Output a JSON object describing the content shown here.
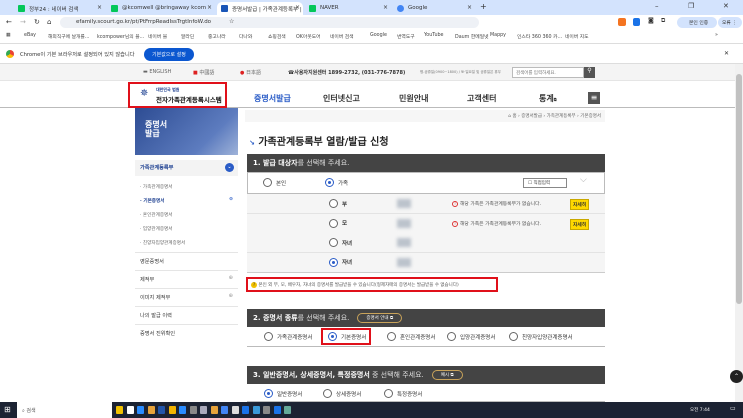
{
  "browser": {
    "tabs": [
      {
        "label": "정부24 : 네이버 검색"
      },
      {
        "label": "@kcomwell @bringaway kcom"
      },
      {
        "label": "증명서발급 | 가족관계등록부 |",
        "active": true
      },
      {
        "label": "NAVER"
      },
      {
        "label": "Google"
      }
    ],
    "url": "efamily.scourt.go.kr/pt/PtFrrpReadIssTrgtInfoW.do",
    "profile_label": "본인 인증",
    "menu_label": "오류",
    "bookmarks": [
      "eBay",
      "해외직구에 날개를...",
      "kcompower님의 블...",
      "네이버 블",
      "알라딘",
      "중고나라",
      "다나와",
      "쇼핑검색",
      "OK아웃도어",
      "네이버 검색",
      "Google",
      "번역도구",
      "YouTube",
      "Daum 한메일넷",
      "Mappy",
      "인스타 360 360 카...",
      "네이버 지도"
    ],
    "banner_text": "Chrome이 기본 브라우저로 설정되어 있지 않습니다",
    "banner_button": "기본값으로 설정"
  },
  "site": {
    "languages": [
      "ENGLISH",
      "中國語",
      "日本語"
    ],
    "helpdesk": "사용자지원센터 1899-2732, (031-776-7878)",
    "hours": "평-공휴일(0900~1800) / 토·일요일 및 공휴일은 휴무",
    "search_placeholder": "검색어를 입력하세요.",
    "logo_small": "대한민국 법원",
    "logo_title": "전자가족관계등록시스템",
    "nav": [
      "증명서발급",
      "인터넷신고",
      "민원안내",
      "고객센터",
      "통계"
    ],
    "breadcrumb": [
      "홈",
      "증명서발급",
      "가족관계등록부",
      "기본증명서"
    ],
    "side_banner": "증명서 발급",
    "sidebar": {
      "group": "가족관계등록부",
      "sub": [
        "가족관계증명서",
        "기본증명서",
        "혼인관계증명서",
        "입양관계증명서",
        "친양자입양관계증명서"
      ],
      "active_sub": 1,
      "items": [
        "영문증명서",
        "제적부",
        "이미지 제적부",
        "나의 발급 이력",
        "증명서 진위확인"
      ]
    },
    "page_title": "가족관계등록부 열람/발급 신청",
    "section1": {
      "bold": "1. 발급 대상자",
      "rest": "를 선택해 주세요.",
      "options": [
        "본인",
        "가족"
      ],
      "selected": 1,
      "direct_input": "직접입력",
      "family": [
        {
          "relation": "부",
          "notice": "해당 가족은 가족관계등록부가 없습니다.",
          "button": "자세히"
        },
        {
          "relation": "모",
          "notice": "해당 가족은 가족관계등록부가 없습니다.",
          "button": "자세히"
        },
        {
          "relation": "자녀"
        },
        {
          "relation": "자녀",
          "selected": true
        }
      ],
      "note": "본인 외 부, 모, 배우자, 자녀의 증명서를 발급받을 수 있습니다(형제자매의 증명서는 발급받을 수 없습니다)"
    },
    "section2": {
      "bold": "2. 증명서 종류",
      "rest": "를 선택해 주세요.",
      "guide": "증명서 안내",
      "options": [
        "가족관계증명서",
        "기본증명서",
        "혼인관계증명서",
        "입양관계증명서",
        "친양자입양관계증명서"
      ],
      "selected": 1
    },
    "section3": {
      "bold": "3. 일반증명서, 상세증명서, 특정증명서",
      "rest": " 중 선택해 주세요.",
      "example": "예시",
      "options": [
        "일반증명서",
        "상세증명서",
        "특정증명서"
      ],
      "selected": 0
    }
  },
  "taskbar": {
    "search": "검색",
    "time": "오전 7:44"
  },
  "colors": {
    "accent": "#2a5cc7",
    "highlight": "#e0101a",
    "section_header": "#444444",
    "detail_button": "#ffd800"
  }
}
